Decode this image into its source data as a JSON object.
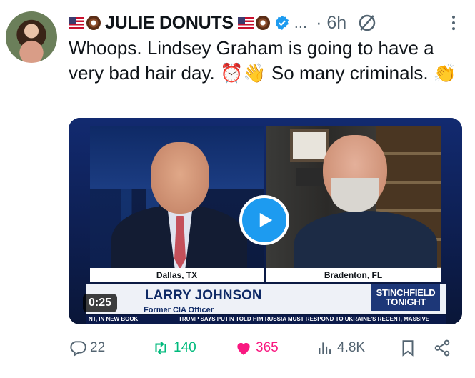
{
  "author": {
    "display_name": "JULIE DONUTS",
    "prefix_emoji": [
      "us-flag",
      "donut"
    ],
    "suffix_emoji": [
      "us-flag",
      "donut"
    ],
    "verified": true,
    "handle_truncation": "...",
    "time": "· 6h"
  },
  "tweet": {
    "text": "Whoops. Lindsey Graham is going to have a very bad hair day. ⏰👋 So many criminals. 👏"
  },
  "media": {
    "duration": "0:25",
    "location_left": "Dallas, TX",
    "location_right": "Bradenton, FL",
    "lower_third_name": "LARRY JOHNSON",
    "lower_third_title": "Former CIA Officer",
    "show_logo_line1": "STINCHFIELD",
    "show_logo_line2": "TONIGHT",
    "ticker_left": "NT, IN NEW BOOK",
    "ticker_right": "TRUMP SAYS PUTIN TOLD HIM RUSSIA MUST RESPOND TO UKRAINE'S RECENT, MASSIVE"
  },
  "actions": {
    "replies": "22",
    "retweets": "140",
    "likes": "365",
    "views": "4.8K"
  },
  "colors": {
    "accent": "#1d9bf0",
    "retweet": "#00ba7c",
    "like": "#f91880",
    "muted": "#536471"
  }
}
